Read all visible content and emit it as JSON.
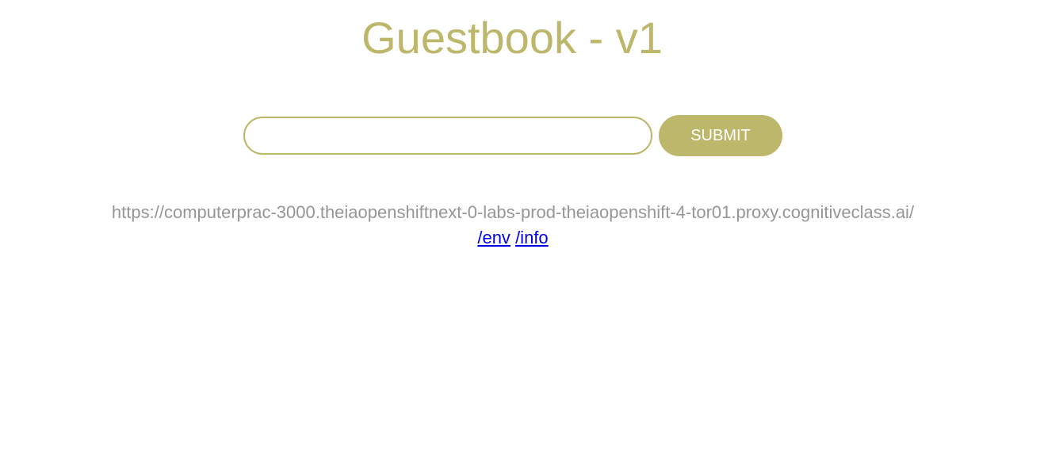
{
  "header": {
    "title": "Guestbook - v1"
  },
  "form": {
    "input_value": "",
    "input_placeholder": "",
    "submit_label": "SUBMIT"
  },
  "info": {
    "host_url": "https://computerprac-3000.theiaopenshiftnext-0-labs-prod-theiaopenshift-4-tor01.proxy.cognitiveclass.ai/",
    "links": [
      {
        "label": "/env"
      },
      {
        "label": "/info"
      }
    ]
  },
  "colors": {
    "accent": "#bdb76b",
    "host_text": "#969696",
    "link": "#0000ee",
    "background": "#ffffff"
  }
}
